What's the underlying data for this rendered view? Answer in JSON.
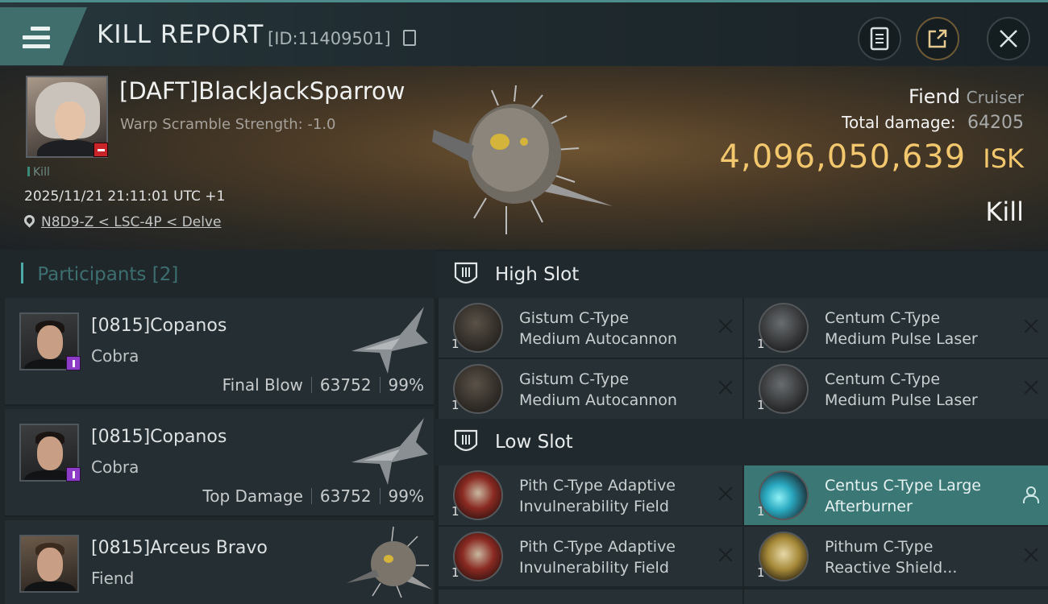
{
  "header": {
    "title": "KILL REPORT",
    "report_id": "[ID:11409501]",
    "icons": [
      "menu-icon",
      "copy-icon",
      "document-icon",
      "share-icon",
      "close-icon"
    ]
  },
  "victim": {
    "name": "[DAFT]BlackJackSparrow",
    "warp_scramble": "Warp Scramble Strength: -1.0",
    "tag": "Kill",
    "datetime": "2025/11/21 21:11:01 UTC +1",
    "location": "N8D9-Z < LSC-4P < Delve",
    "ship_name": "Fiend",
    "ship_class": "Cruiser",
    "total_damage_label": "Total damage:",
    "total_damage": "64205",
    "isk_value": "4,096,050,639",
    "isk_unit": "ISK",
    "result": "Kill"
  },
  "participants": {
    "label": "Participants",
    "count": "[2]",
    "rows": [
      {
        "name": "[0815]Copanos",
        "ship": "Cobra",
        "role": "Final Blow",
        "damage": "63752",
        "percent": "99%"
      },
      {
        "name": "[0815]Copanos",
        "ship": "Cobra",
        "role": "Top Damage",
        "damage": "63752",
        "percent": "99%"
      },
      {
        "name": "[0815]Arceus Bravo",
        "ship": "Fiend"
      }
    ]
  },
  "fittings": {
    "high_slot": {
      "title": "High Slot",
      "modules": [
        {
          "name": "Gistum C-Type\nMedium Autocannon",
          "qty": "1"
        },
        {
          "name": "Centum C-Type\nMedium Pulse Laser",
          "qty": "1"
        },
        {
          "name": "Gistum C-Type\nMedium Autocannon",
          "qty": "1"
        },
        {
          "name": "Centum C-Type\nMedium Pulse Laser",
          "qty": "1"
        }
      ]
    },
    "low_slot": {
      "title": "Low Slot",
      "modules": [
        {
          "name": "Pith C-Type Adaptive\nInvulnerability Field",
          "qty": "1"
        },
        {
          "name": "Centus C-Type Large\nAfterburner",
          "qty": "1"
        },
        {
          "name": "Pith C-Type Adaptive\nInvulnerability Field",
          "qty": "1"
        },
        {
          "name": "Pithum C-Type\nReactive Shield...",
          "qty": "1"
        }
      ]
    }
  },
  "colors": {
    "accent": "#3f6e6c",
    "isk_gold": "#f2c76e",
    "highlight_row": "#3a7775",
    "loss_badge": "#c8242a",
    "participant_badge": "#8c3cc7"
  }
}
